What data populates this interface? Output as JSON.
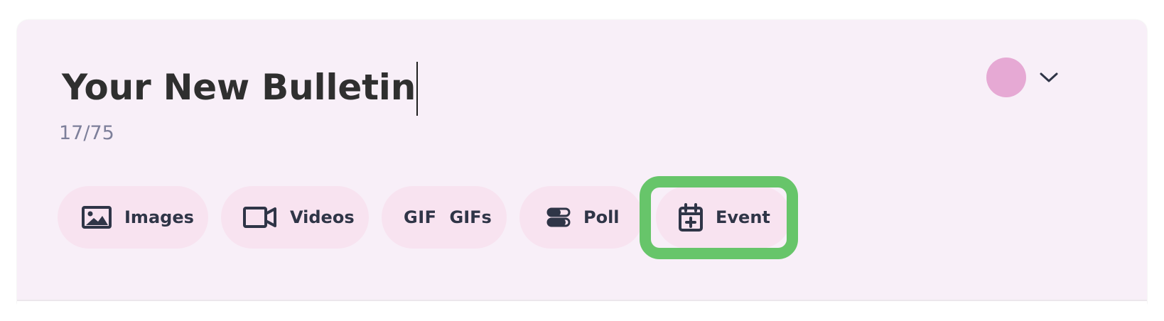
{
  "editor": {
    "title": "Your New Bulletin",
    "character_count": "17/75",
    "avatar_color": "#e6a9d4"
  },
  "toolbar": {
    "images_label": "Images",
    "videos_label": "Videos",
    "gifs_icon_text": "GIF",
    "gifs_label": "GIFs",
    "poll_label": "Poll",
    "event_label": "Event"
  },
  "highlight": {
    "target": "event-button",
    "color": "#67c56a"
  },
  "colors": {
    "card_background": "#f8eff8",
    "pill_background": "#f8e3f0",
    "text_primary": "#2f2f2f",
    "text_secondary": "#7d7f9a",
    "icon_color": "#2f3547"
  },
  "icons": {
    "images": "image-icon",
    "videos": "video-camera-icon",
    "gifs": "gif-icon",
    "poll": "poll-icon",
    "event": "calendar-plus-icon",
    "author_picker": "chevron-down-icon"
  }
}
